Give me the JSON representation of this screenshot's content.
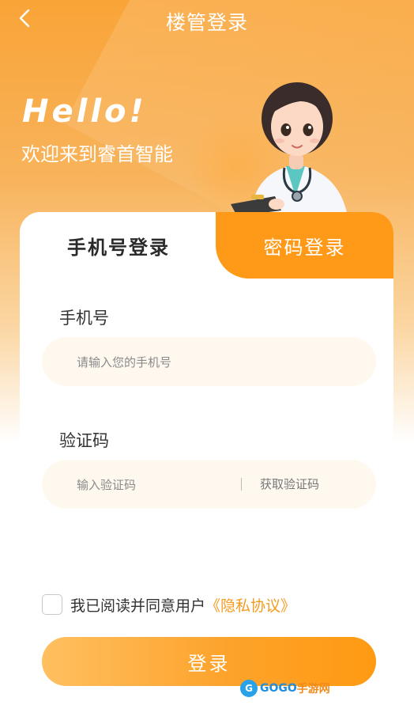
{
  "header": {
    "title": "楼管登录",
    "back_icon": "chevron-left-icon"
  },
  "hero": {
    "greeting": "Hello!",
    "welcome": "欢迎来到睿首智能"
  },
  "tabs": [
    {
      "label": "手机号登录",
      "active": true
    },
    {
      "label": "密码登录",
      "active": false
    }
  ],
  "form": {
    "phone_label": "手机号",
    "phone_placeholder": "请输入您的手机号",
    "code_label": "验证码",
    "code_placeholder": "输入验证码",
    "get_code": "获取验证码"
  },
  "agreement": {
    "checked": false,
    "text": "我已阅读并同意用户",
    "link": "《隐私协议》"
  },
  "login_button": "登录",
  "watermark": {
    "mark": "G",
    "part1": "GOGO",
    "part2": "手游网"
  },
  "colors": {
    "accent": "#ff9a19",
    "link": "#f49a1e"
  }
}
